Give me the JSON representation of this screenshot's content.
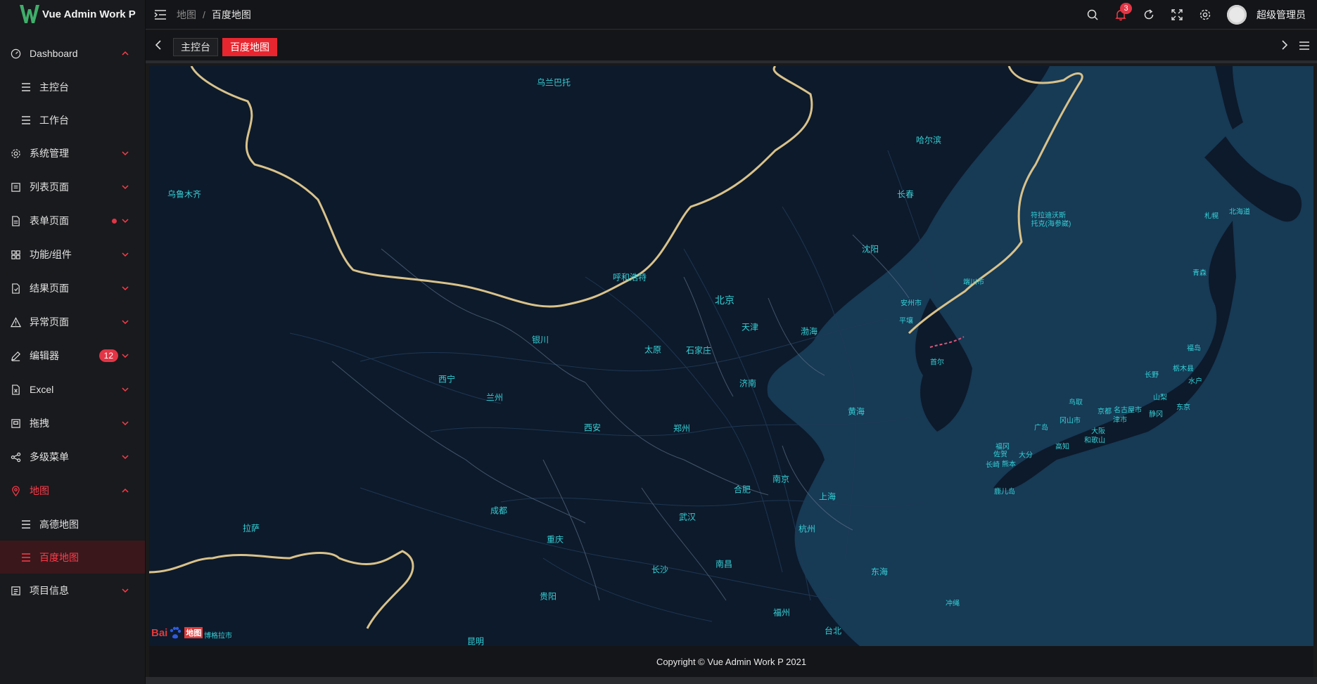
{
  "app": {
    "title": "Vue Admin Work P"
  },
  "sidebar": {
    "items": [
      {
        "label": "Dashboard",
        "icon": "dashboard-icon",
        "expanded": true,
        "children": [
          {
            "label": "主控台"
          },
          {
            "label": "工作台"
          }
        ]
      },
      {
        "label": "系统管理",
        "icon": "gear-icon"
      },
      {
        "label": "列表页面",
        "icon": "list-icon"
      },
      {
        "label": "表单页面",
        "icon": "form-icon",
        "dot": true
      },
      {
        "label": "功能/组件",
        "icon": "grid-icon"
      },
      {
        "label": "结果页面",
        "icon": "result-icon"
      },
      {
        "label": "异常页面",
        "icon": "warning-icon"
      },
      {
        "label": "编辑器",
        "icon": "edit-icon",
        "badge": "12"
      },
      {
        "label": "Excel",
        "icon": "excel-icon"
      },
      {
        "label": "拖拽",
        "icon": "drag-icon"
      },
      {
        "label": "多级菜单",
        "icon": "share-icon"
      },
      {
        "label": "地图",
        "icon": "location-icon",
        "expanded": true,
        "children": [
          {
            "label": "高德地图"
          },
          {
            "label": "百度地图",
            "active": true
          }
        ]
      },
      {
        "label": "项目信息",
        "icon": "info-icon"
      }
    ]
  },
  "header": {
    "breadcrumb": [
      "地图",
      "百度地图"
    ],
    "breadcrumb_sep": "/",
    "notification_count": "3",
    "username": "超级管理员"
  },
  "tabs": [
    {
      "label": "主控台",
      "active": false
    },
    {
      "label": "百度地图",
      "active": true
    }
  ],
  "map": {
    "cities": [
      {
        "name": "乌兰巴托"
      },
      {
        "name": "哈尔滨"
      },
      {
        "name": "乌鲁木齐"
      },
      {
        "name": "长春"
      },
      {
        "name": "符拉迪沃斯"
      },
      {
        "name": "托克(海参崴)"
      },
      {
        "name": "札幌"
      },
      {
        "name": "北海道"
      },
      {
        "name": "沈阳"
      },
      {
        "name": "呼和浩特"
      },
      {
        "name": "北京"
      },
      {
        "name": "端川市"
      },
      {
        "name": "安州市"
      },
      {
        "name": "青森"
      },
      {
        "name": "平壤"
      },
      {
        "name": "天津"
      },
      {
        "name": "渤海"
      },
      {
        "name": "银川"
      },
      {
        "name": "太原"
      },
      {
        "name": "石家庄"
      },
      {
        "name": "首尔"
      },
      {
        "name": "福岛"
      },
      {
        "name": "西宁"
      },
      {
        "name": "栃木县"
      },
      {
        "name": "长野"
      },
      {
        "name": "济南"
      },
      {
        "name": "水户"
      },
      {
        "name": "兰州"
      },
      {
        "name": "山梨"
      },
      {
        "name": "鸟取"
      },
      {
        "name": "黄海"
      },
      {
        "name": "东京"
      },
      {
        "name": "京都"
      },
      {
        "name": "名古屋市"
      },
      {
        "name": "静冈"
      },
      {
        "name": "冈山市"
      },
      {
        "name": "津市"
      },
      {
        "name": "西安"
      },
      {
        "name": "郑州"
      },
      {
        "name": "广岛"
      },
      {
        "name": "大阪"
      },
      {
        "name": "和歌山"
      },
      {
        "name": "福冈"
      },
      {
        "name": "高知"
      },
      {
        "name": "佐贺"
      },
      {
        "name": "大分"
      },
      {
        "name": "长崎"
      },
      {
        "name": "熊本"
      },
      {
        "name": "南京"
      },
      {
        "name": "鹿儿岛"
      },
      {
        "name": "合肥"
      },
      {
        "name": "上海"
      },
      {
        "name": "成都"
      },
      {
        "name": "武汉"
      },
      {
        "name": "拉萨"
      },
      {
        "name": "杭州"
      },
      {
        "name": "重庆"
      },
      {
        "name": "南昌"
      },
      {
        "name": "长沙"
      },
      {
        "name": "东海"
      },
      {
        "name": "贵阳"
      },
      {
        "name": "冲绳"
      },
      {
        "name": "福州"
      },
      {
        "name": "台北"
      },
      {
        "name": "昆明"
      },
      {
        "name": "博格拉市"
      }
    ],
    "logo_text_a": "Bai",
    "logo_text_b": "地图"
  },
  "footer": {
    "copyright": "Copyright © Vue Admin Work P 2021"
  },
  "colors": {
    "accent": "#e8262f",
    "map_land": "#0d1a2b",
    "map_sea": "#173a55",
    "border": "#d9c28a",
    "label": "#35d0d6"
  }
}
